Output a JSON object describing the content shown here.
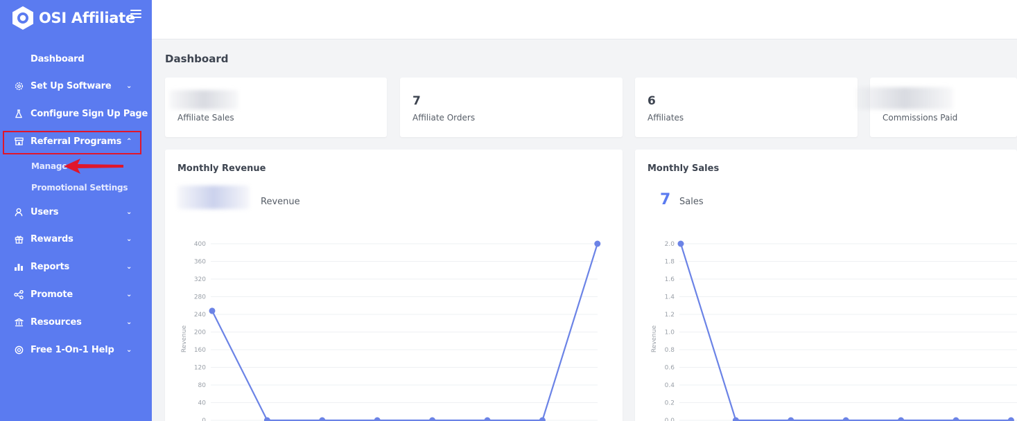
{
  "brand": {
    "name": "OSI Affiliate"
  },
  "sidebar": {
    "items": [
      {
        "label": "Dashboard",
        "icon": "none"
      },
      {
        "label": "Set Up Software",
        "icon": "gear-icon"
      },
      {
        "label": "Configure Sign Up Page",
        "icon": "flask-icon"
      },
      {
        "label": "Referral Programs",
        "icon": "store-icon"
      },
      {
        "label": "Users",
        "icon": "user-icon"
      },
      {
        "label": "Rewards",
        "icon": "gift-icon"
      },
      {
        "label": "Reports",
        "icon": "bar-chart-icon"
      },
      {
        "label": "Promote",
        "icon": "share-icon"
      },
      {
        "label": "Resources",
        "icon": "bank-icon"
      },
      {
        "label": "Free 1-On-1 Help",
        "icon": "lifebuoy-icon"
      }
    ],
    "subitems": [
      {
        "label": "Manage"
      },
      {
        "label": "Promotional Settings"
      }
    ]
  },
  "page": {
    "title": "Dashboard"
  },
  "stats": [
    {
      "value": "",
      "label": "Affiliate Sales"
    },
    {
      "value": "7",
      "label": "Affiliate Orders"
    },
    {
      "value": "6",
      "label": "Affiliates"
    },
    {
      "value": "",
      "label": "Commissions Paid"
    }
  ],
  "revenue_card": {
    "title": "Monthly Revenue",
    "big": "",
    "sub": "Revenue"
  },
  "sales_card": {
    "title": "Monthly Sales",
    "big": "7",
    "sub": "Sales"
  },
  "colors": {
    "sidebar": "#5b7bf0",
    "accent": "#6b83e6",
    "highlight": "#e0162b"
  },
  "chart_data": [
    {
      "type": "line",
      "title": "Monthly Revenue",
      "ylabel": "Revenue",
      "ylim": [
        0,
        400
      ],
      "yticks": [
        0,
        40,
        80,
        120,
        160,
        200,
        240,
        280,
        320,
        360,
        400
      ],
      "series": [
        {
          "values": [
            248,
            0,
            0,
            0,
            0,
            0,
            0,
            400
          ]
        }
      ]
    },
    {
      "type": "line",
      "title": "Monthly Sales",
      "ylabel": "Revenue",
      "ylim": [
        0,
        2.0
      ],
      "yticks": [
        "0.0",
        "0.2",
        "0.4",
        "0.6",
        "0.8",
        "1.0",
        "1.2",
        "1.4",
        "1.6",
        "1.8",
        "2.0"
      ],
      "series": [
        {
          "values": [
            2,
            0,
            0,
            0,
            0,
            0,
            0
          ]
        }
      ]
    }
  ]
}
